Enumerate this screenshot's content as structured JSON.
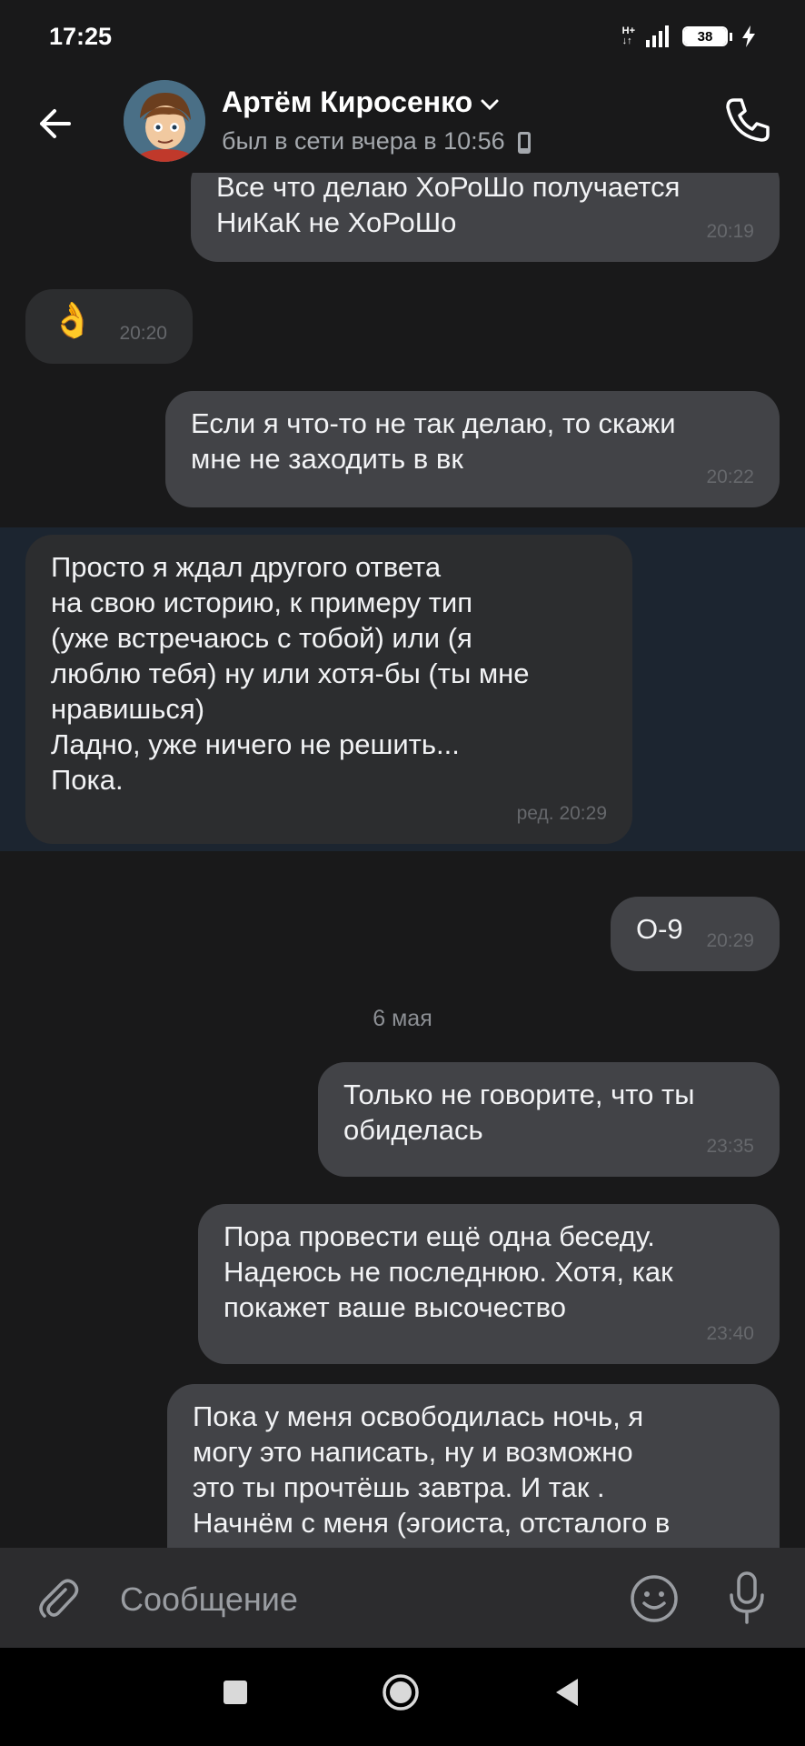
{
  "status_bar": {
    "time": "17:25",
    "network_top": "H+",
    "network_bottom": "↓↑",
    "battery": "38"
  },
  "header": {
    "contact_name": "Артём Киросенко",
    "contact_status": "был в сети вчера в 10:56"
  },
  "messages": [
    {
      "text": "Все что делаю ХоРоШо получается\nНиКаК не ХоРоШо",
      "time": "20:19"
    },
    {
      "text": "👌",
      "time": "20:20"
    },
    {
      "text": "Если я что-то не так делаю, то скажи\nмне не заходить в вк",
      "time": "20:22"
    },
    {
      "text": "Просто я ждал другого ответа\nна свою историю, к примеру тип\n(уже встречаюсь с тобой) или (я\nлюблю тебя) ну или хотя-бы (ты мне\nнравишься)\nЛадно, уже ничего не решить...\nПока.",
      "time": "ред. 20:29"
    },
    {
      "text": "О-9",
      "time": "20:29"
    },
    {
      "text": "Только не говорите, что ты\nобиделась",
      "time": "23:35"
    },
    {
      "text": "Пора провести ещё одна беседу.\nНадеюсь не последнюю. Хотя, как\nпокажет ваше высочество",
      "time": "23:40"
    },
    {
      "text": "Пока у меня освободилась ночь, я\nмогу это написать, ну и возможно\nэто ты прочтёшь завтра.  И так .\nНачнём с меня (эгоиста, отсталого в",
      "time": ""
    }
  ],
  "date_separator": "6 мая",
  "composer": {
    "placeholder": "Сообщение"
  },
  "colors": {
    "background": "#19191a",
    "outgoing_bubble": "#424347",
    "incoming_bubble": "#2c2d2f",
    "highlight": "#1c2530"
  }
}
